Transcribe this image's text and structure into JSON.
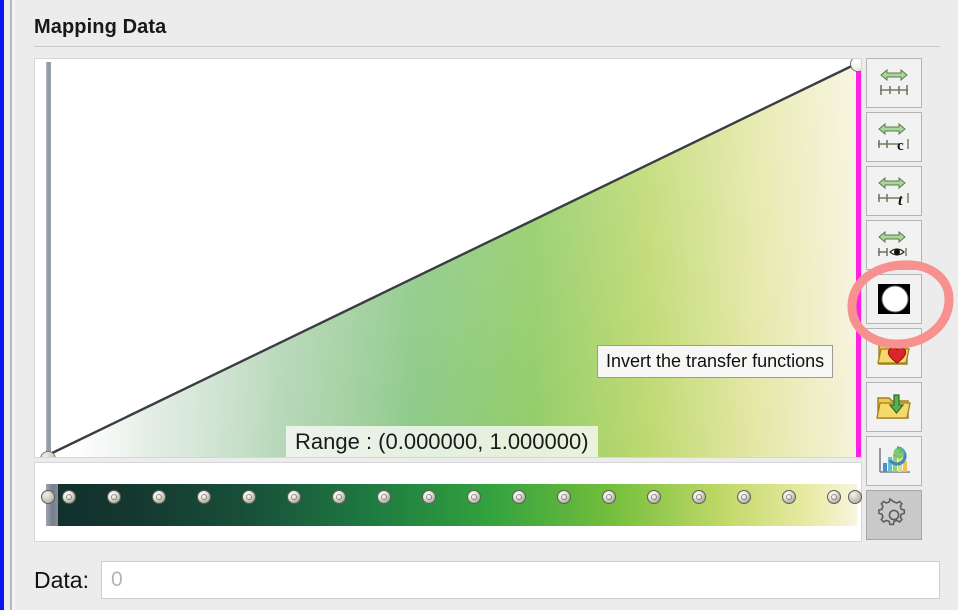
{
  "window": {
    "title": "Mapping Data"
  },
  "transfer_function": {
    "range_label": "Range : (0.000000, 1.000000)",
    "range_min": "0.000000",
    "range_max": "1.000000",
    "left_boundary_color": "#8e98a3",
    "right_boundary_color": "#ff21e6",
    "opacity_ramp": {
      "points": [
        {
          "x": 0.0,
          "opacity": 0.0
        },
        {
          "x": 1.0,
          "opacity": 1.0
        }
      ]
    }
  },
  "tooltip": {
    "text": "Invert the transfer functions",
    "visible": true
  },
  "annotation": {
    "shape": "hand-drawn-ellipse",
    "color": "#f7918f",
    "targets": "invert-transfer-functions-button"
  },
  "colorbar": {
    "stops": [
      {
        "pos": 0.0,
        "color": "#12302e"
      },
      {
        "pos": 0.1,
        "color": "#14372f"
      },
      {
        "pos": 0.25,
        "color": "#18503a"
      },
      {
        "pos": 0.4,
        "color": "#1e7a41"
      },
      {
        "pos": 0.55,
        "color": "#33a33e"
      },
      {
        "pos": 0.7,
        "color": "#76bf3c"
      },
      {
        "pos": 0.84,
        "color": "#c4d96a"
      },
      {
        "pos": 0.94,
        "color": "#e8eaa4"
      },
      {
        "pos": 1.0,
        "color": "#f7f5dd"
      }
    ],
    "handle_count": 18,
    "handle_name": "colorbar-control-point"
  },
  "toolbar": {
    "buttons": [
      {
        "name": "rescale-to-data-range-button",
        "icon": "arrows-ruler-icon",
        "label": "",
        "state": "enabled"
      },
      {
        "name": "rescale-color-map-button",
        "icon": "arrows-ruler-c-icon",
        "label": "c",
        "state": "enabled"
      },
      {
        "name": "rescale-opacity-map-button",
        "icon": "arrows-ruler-t-icon",
        "label": "t",
        "state": "enabled"
      },
      {
        "name": "rescale-to-visible-range-button",
        "icon": "arrows-ruler-eye-icon",
        "label": "",
        "state": "enabled"
      },
      {
        "name": "invert-transfer-functions-button",
        "icon": "invert-circle-icon",
        "label": "",
        "state": "highlighted"
      },
      {
        "name": "choose-preset-button",
        "icon": "folder-heart-icon",
        "label": "",
        "state": "enabled"
      },
      {
        "name": "save-to-preset-button",
        "icon": "folder-download-icon",
        "label": "",
        "state": "enabled"
      },
      {
        "name": "reset-histogram-button",
        "icon": "histogram-refresh-icon",
        "label": "",
        "state": "enabled"
      },
      {
        "name": "transfer-function-settings-button",
        "icon": "gear-icon",
        "label": "",
        "state": "pressed"
      }
    ]
  },
  "data_field": {
    "label": "Data:",
    "value": "",
    "placeholder": "0"
  }
}
